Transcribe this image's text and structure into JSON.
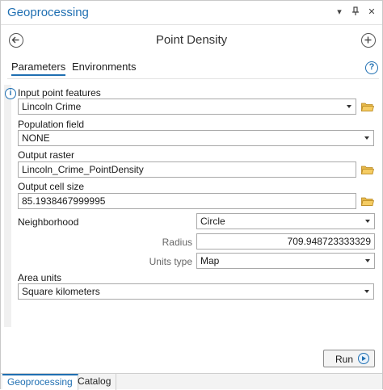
{
  "window": {
    "title": "Geoprocessing",
    "controls": {
      "menu_glyph": "▾",
      "pin_glyph": "✚",
      "close_glyph": "✕"
    }
  },
  "tool": {
    "title": "Point Density",
    "back_icon": "back-arrow-icon",
    "add_icon": "plus-circle-icon"
  },
  "tabs": [
    {
      "label": "Parameters",
      "active": true
    },
    {
      "label": "Environments",
      "active": false
    }
  ],
  "help": {
    "glyph": "?"
  },
  "info": {
    "glyph": "i"
  },
  "params": {
    "input_point_features": {
      "label": "Input point features",
      "value": "Lincoln Crime"
    },
    "population_field": {
      "label": "Population field",
      "value": "NONE"
    },
    "output_raster": {
      "label": "Output raster",
      "value": "Lincoln_Crime_PointDensity"
    },
    "output_cell_size": {
      "label": "Output cell size",
      "value": "85.1938467999995"
    },
    "neighborhood": {
      "label": "Neighborhood",
      "value": "Circle"
    },
    "radius": {
      "label": "Radius",
      "value": "709.948723333329"
    },
    "units_type": {
      "label": "Units type",
      "value": "Map"
    },
    "area_units": {
      "label": "Area units",
      "value": "Square kilometers"
    }
  },
  "actions": {
    "run_label": "Run"
  },
  "bottom_tabs": [
    {
      "label": "Geoprocessing",
      "active": true
    },
    {
      "label": "Catalog",
      "active": false
    }
  ],
  "colors": {
    "accent": "#1f6fb2",
    "folder": "#d9a520"
  }
}
